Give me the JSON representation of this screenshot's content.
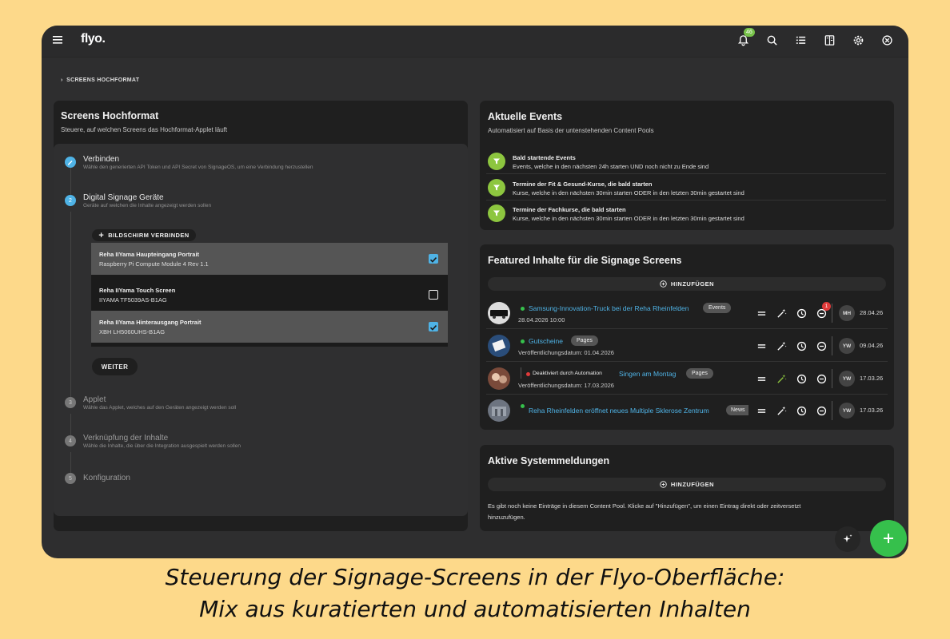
{
  "app": {
    "logo": "flyo.",
    "notification_count": "46",
    "topbar_icons": [
      "bell-icon",
      "search-icon",
      "list-icon",
      "book-icon",
      "gear-icon",
      "close-circle-icon"
    ]
  },
  "breadcrumb": "SCREENS HOCHFORMAT",
  "left_card": {
    "title": "Screens Hochformat",
    "subtitle": "Steuere, auf welchen Screens das Hochformat-Applet läuft",
    "steps": [
      {
        "num": "1",
        "title": "Verbinden",
        "subtitle": "Wähle den generierten API Token und API Secret von SignageOS, um eine Verbindung herzustellen"
      },
      {
        "num": "2",
        "title": "Digital Signage Geräte",
        "subtitle": "Geräte auf welchen die Inhalte angezeigt werden sollen"
      },
      {
        "num": "3",
        "title": "Applet",
        "subtitle": "Wähle das Applet, welches auf den Geräten angezeigt werden soll"
      },
      {
        "num": "4",
        "title": "Verknüpfung der Inhalte",
        "subtitle": "Wähle die Inhalte, die über die Integration ausgespielt werden sollen"
      },
      {
        "num": "5",
        "title": "Konfiguration",
        "subtitle": ""
      }
    ],
    "connect_button": "BILDSCHIRM VERBINDEN",
    "devices": [
      {
        "name": "Reha IIYama Haupteingang Portrait",
        "model": "Raspberry Pi Compute Module 4 Rev 1.1",
        "checked": true
      },
      {
        "name": "Reha IIYama Touch Screen",
        "model": "IIYAMA TF5039AS-B1AG",
        "checked": false
      },
      {
        "name": "Reha IIYama Hinterausgang Portrait",
        "model": "XBH LH5060UHS-B1AG",
        "checked": true
      }
    ],
    "next_button": "WEITER"
  },
  "events_card": {
    "title": "Aktuelle Events",
    "subtitle": "Automatisiert auf Basis der untenstehenden Content Pools",
    "rows": [
      {
        "title": "Bald startende Events",
        "subtitle": "Events, welche in den nächsten 24h starten UND noch nicht zu Ende sind"
      },
      {
        "title": "Termine der Fit & Gesund-Kurse, die bald starten",
        "subtitle": "Kurse, welche in den nächsten 30min starten ODER in den letzten 30min gestartet sind"
      },
      {
        "title": "Termine der Fachkurse, die bald starten",
        "subtitle": "Kurse, welche in den nächsten 30min starten ODER in den letzten 30min gestartet sind"
      }
    ]
  },
  "featured_card": {
    "title": "Featured Inhalte für die Signage Screens",
    "add_label": "HINZUFÜGEN",
    "rows": [
      {
        "status_label": "",
        "title": "Samsung-Innovation-Truck bei der Reha Rheinfelden",
        "tag": "Events",
        "sub": "28.04.2026 10:00",
        "initials": "MH",
        "date": "28.04.26",
        "badge": "1"
      },
      {
        "status_label": "",
        "title": "Gutscheine",
        "tag": "Pages",
        "sub": "Veröffentlichungsdatum: 01.04.2026",
        "initials": "YW",
        "date": "09.04.26",
        "badge": ""
      },
      {
        "status_label": "Deaktiviert durch Automation",
        "title": "Singen am Montag",
        "tag": "Pages",
        "sub": "Veröffentlichungsdatum: 17.03.2026",
        "initials": "YW",
        "date": "17.03.26",
        "badge": ""
      },
      {
        "status_label": "",
        "title": "Reha Rheinfelden eröffnet neues Multiple Sklerose Zentrum",
        "tag": "News",
        "sub": "",
        "initials": "YW",
        "date": "17.03.26",
        "badge": ""
      }
    ]
  },
  "alerts_card": {
    "title": "Aktive Systemmeldungen",
    "add_label": "HINZUFÜGEN",
    "empty_text_1": "Es gibt noch keine Einträge in diesem Content Pool. Klicke auf \"Hinzufügen\", um einen Eintrag direkt oder zeitversetzt",
    "empty_text_2": "hinzuzufügen."
  },
  "caption": {
    "line1": "Steuerung der Signage-Screens in der Flyo-Oberfläche:",
    "line2": "Mix aus kuratierten und automatisierten Inhalten"
  },
  "colors": {
    "accent_blue": "#4fb3e6",
    "green": "#8dc63f",
    "fab_green": "#36c04c",
    "red": "#e03a3a"
  }
}
